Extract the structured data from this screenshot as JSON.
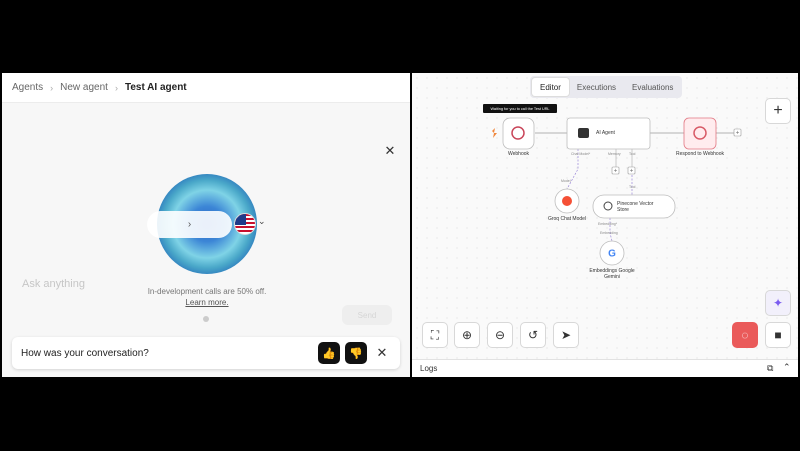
{
  "breadcrumb": {
    "items": [
      "Agents",
      "New agent"
    ],
    "current": "Test AI agent"
  },
  "chat": {
    "input_placeholder": "Ask anything",
    "discount_text": "In-development calls are 50% off.",
    "learn_more": "Learn more.",
    "send_label": "Send",
    "feedback_prompt": "How was your conversation?"
  },
  "workflow": {
    "tabs": [
      "Editor",
      "Executions",
      "Evaluations"
    ],
    "active_tab": "Editor",
    "tooltip": "Waiting for you to call the Test URL",
    "nodes": {
      "webhook": "Webhook",
      "ai_agent": "AI Agent",
      "respond": "Respond to Webhook",
      "groq": "Groq Chat Model",
      "pinecone_line1": "Pinecone Vector",
      "pinecone_line2": "Store",
      "embeddings_line1": "Embeddings Google",
      "embeddings_line2": "Gemini"
    },
    "ports": {
      "chat_model": "Chat Model*",
      "memory": "Memory",
      "tool": "Tool",
      "model": "Model",
      "embedding": "Embedding*",
      "embedding2": "Embedding"
    },
    "logs_label": "Logs"
  },
  "colors": {
    "accent_run": "#ea5a5a",
    "brand_purple": "#7b5cf0"
  }
}
